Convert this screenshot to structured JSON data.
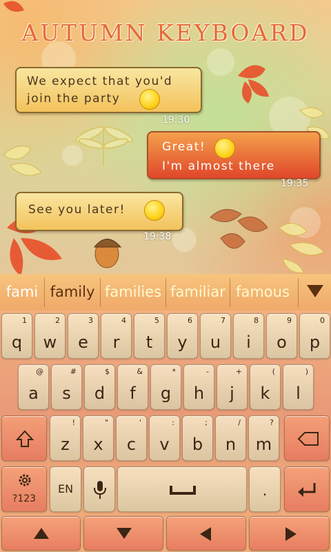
{
  "title": "AUTUMN KEYBOARD",
  "messages": [
    {
      "line1": "We expect that you'd",
      "line2": "join the party",
      "time": "19:30"
    },
    {
      "line1": "Great!",
      "line2": "I'm almost there",
      "time": "19:35"
    },
    {
      "line1": "See you later!",
      "time": "19:38"
    }
  ],
  "suggestions": [
    "fami",
    "family",
    "families",
    "familiar",
    "famous"
  ],
  "keys": {
    "row1": [
      {
        "main": "q",
        "hint": "1"
      },
      {
        "main": "w",
        "hint": "2"
      },
      {
        "main": "e",
        "hint": "3"
      },
      {
        "main": "r",
        "hint": "4"
      },
      {
        "main": "t",
        "hint": "5"
      },
      {
        "main": "y",
        "hint": "6"
      },
      {
        "main": "u",
        "hint": "7"
      },
      {
        "main": "i",
        "hint": "8"
      },
      {
        "main": "o",
        "hint": "9"
      },
      {
        "main": "p",
        "hint": "0"
      }
    ],
    "row2": [
      {
        "main": "a",
        "hint": "@"
      },
      {
        "main": "s",
        "hint": "#"
      },
      {
        "main": "d",
        "hint": "$"
      },
      {
        "main": "f",
        "hint": "&"
      },
      {
        "main": "g",
        "hint": "*"
      },
      {
        "main": "h",
        "hint": "-"
      },
      {
        "main": "j",
        "hint": "+"
      },
      {
        "main": "k",
        "hint": "("
      },
      {
        "main": "l",
        "hint": ")"
      }
    ],
    "row3": [
      {
        "main": "z",
        "hint": "!"
      },
      {
        "main": "x",
        "hint": "\""
      },
      {
        "main": "c",
        "hint": "'"
      },
      {
        "main": "v",
        "hint": ":"
      },
      {
        "main": "b",
        "hint": ";"
      },
      {
        "main": "n",
        "hint": "/"
      },
      {
        "main": "m",
        "hint": "?"
      }
    ],
    "shift_icon": "shift-arrow-icon",
    "backspace_icon": "backspace-icon",
    "settings_label": "?123",
    "settings_icon": "gear-icon",
    "lang_label": "EN",
    "mic_icon": "microphone-icon",
    "space_icon": "space-bar-icon",
    "enter_icon": "enter-return-icon",
    "nav": [
      "up-arrow-icon",
      "down-arrow-icon",
      "left-arrow-icon",
      "right-arrow-icon"
    ]
  },
  "colors": {
    "accent": "#e46a3a",
    "outgoing_bubble": "#e0472a",
    "incoming_bubble": "#f3c25c"
  }
}
